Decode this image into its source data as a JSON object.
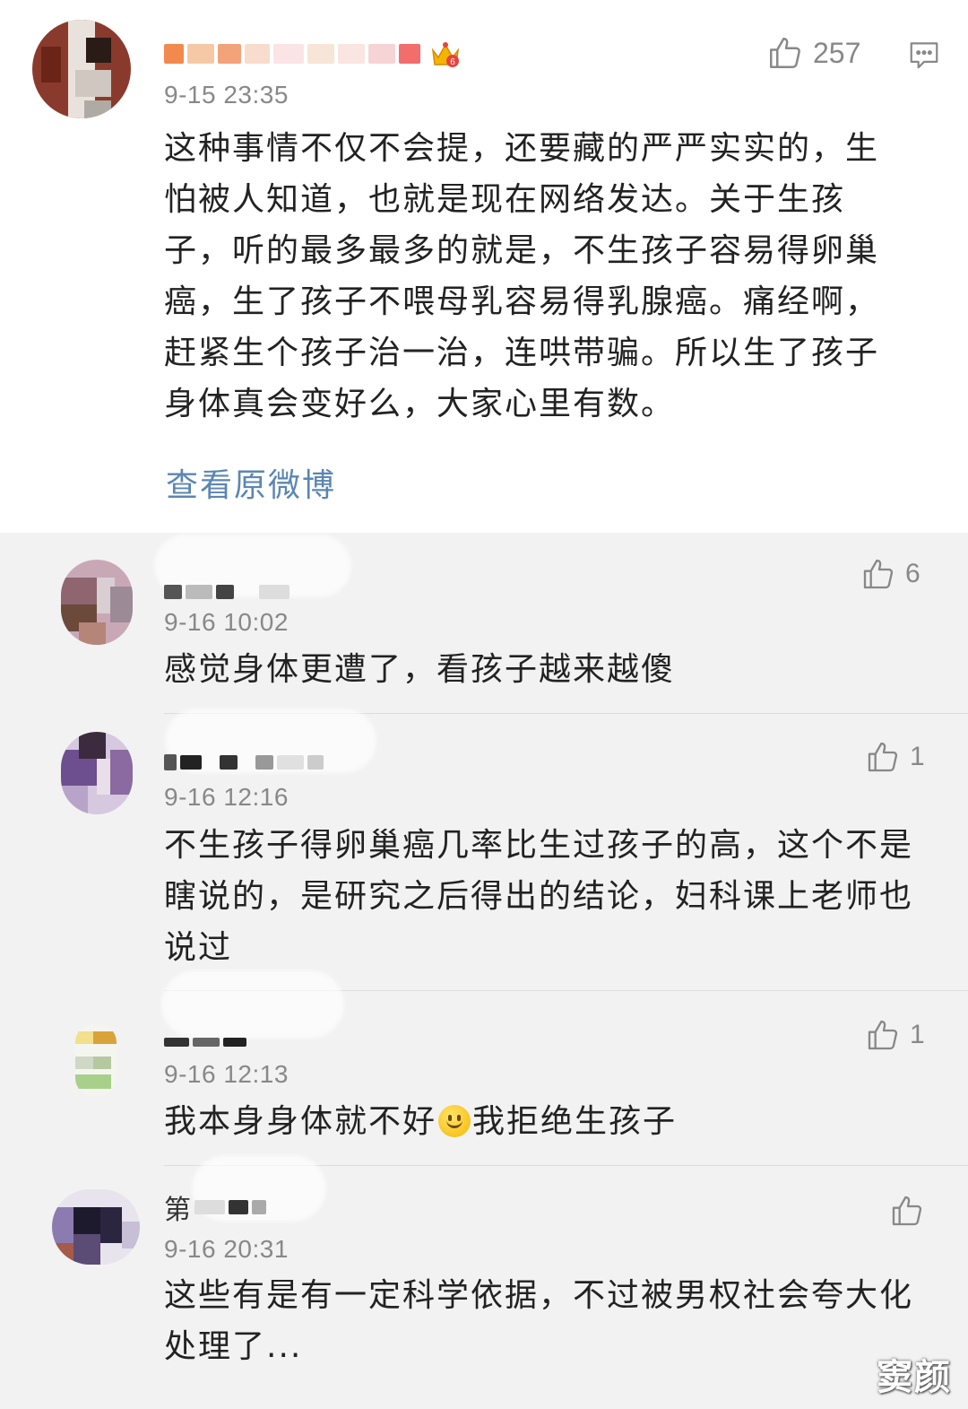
{
  "main_comment": {
    "time": "9-15 23:35",
    "likes": "257",
    "text": "这种事情不仅不会提，还要藏的严严实实的，生怕被人知道，也就是现在网络发达。关于生孩子，听的最多最多的就是，不生孩子容易得卵巢癌，生了孩子不喂母乳容易得乳腺癌。痛经啊，赶紧生个孩子治一治，连哄带骗。所以生了孩子身体真会变好么，大家心里有数。",
    "lines": [
      "这种事情不仅不会提，还要藏的严严实实的，生",
      "怕被人知道，也就是现在网络发达。关于生孩",
      "子，听的最多最多的就是，不生孩子容易得卵巢",
      "癌，生了孩子不喂母乳容易得乳腺癌。痛经啊，",
      "赶紧生个孩子治一治，连哄带骗。所以生了孩子",
      "身体真会变好么，大家心里有数。"
    ],
    "view_original_label": "查看原微博"
  },
  "replies": [
    {
      "name_visible": "",
      "time": "9-16 10:02",
      "likes": "6",
      "lines": [
        "感觉身体更遭了，看孩子越来越傻"
      ]
    },
    {
      "name_visible": "",
      "time": "9-16 12:16",
      "likes": "1",
      "lines": [
        "不生孩子得卵巢癌几率比生过孩子的高，这个不是",
        "瞎说的，是研究之后得出的结论，妇科课上老师也",
        "说过"
      ]
    },
    {
      "name_visible": "",
      "time": "9-16 12:13",
      "likes": "1",
      "text_before_emoji": "我本身身体就不好",
      "text_after_emoji": "我拒绝生孩子"
    },
    {
      "name_visible": "第",
      "time": "9-16 20:31",
      "likes": "",
      "lines": [
        "这些有是有一定科学依据，不过被男权社会夸大化",
        "处理了..."
      ]
    }
  ],
  "watermark": "窦颜",
  "colors": {
    "link": "#5b86b3",
    "reply_bg": "#f2f2f2",
    "meta_gray": "#888888"
  },
  "icons": [
    "thumbs-up-icon",
    "comment-icon",
    "crown-badge-icon",
    "smile-emoji-icon"
  ]
}
